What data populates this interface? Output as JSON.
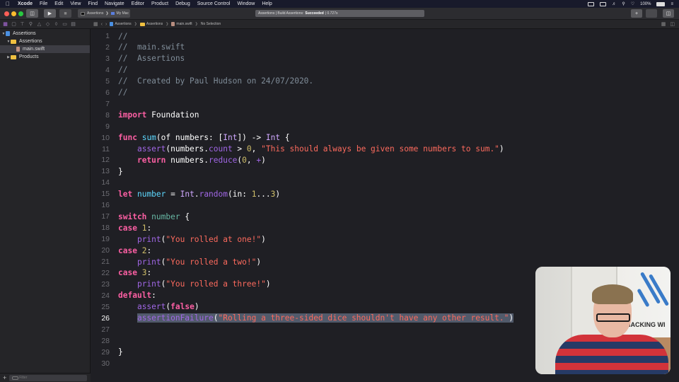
{
  "menubar": {
    "app_name": "Xcode",
    "items": [
      "File",
      "Edit",
      "View",
      "Find",
      "Navigate",
      "Editor",
      "Product",
      "Debug",
      "Source Control",
      "Window",
      "Help"
    ],
    "battery": "100%"
  },
  "toolbar": {
    "scheme": "Assertions",
    "destination": "My Mac",
    "status_prefix": "Assertions | Build Assertions:",
    "status_result": "Succeeded",
    "status_time": "| 0.727s",
    "add_label": "+"
  },
  "jumpbar": {
    "crumbs": [
      "Assertions",
      "Assertions",
      "main.swift",
      "No Selection"
    ]
  },
  "navigator": {
    "items": [
      {
        "label": "Assertions",
        "kind": "project",
        "expanded": true
      },
      {
        "label": "Assertions",
        "kind": "folder",
        "expanded": true
      },
      {
        "label": "main.swift",
        "kind": "swift-file",
        "selected": true
      },
      {
        "label": "Products",
        "kind": "folder",
        "expanded": false
      }
    ],
    "filter_placeholder": "Filter"
  },
  "editor": {
    "current_line": 26,
    "lines": [
      {
        "n": "1",
        "tokens": [
          [
            "c-comment",
            "//"
          ]
        ]
      },
      {
        "n": "2",
        "tokens": [
          [
            "c-comment",
            "//  main.swift"
          ]
        ]
      },
      {
        "n": "3",
        "tokens": [
          [
            "c-comment",
            "//  Assertions"
          ]
        ]
      },
      {
        "n": "4",
        "tokens": [
          [
            "c-comment",
            "//"
          ]
        ]
      },
      {
        "n": "5",
        "tokens": [
          [
            "c-comment",
            "//  Created by Paul Hudson on 24/07/2020."
          ]
        ]
      },
      {
        "n": "6",
        "tokens": [
          [
            "c-comment",
            "//"
          ]
        ]
      },
      {
        "n": "7",
        "tokens": []
      },
      {
        "n": "8",
        "tokens": [
          [
            "c-kw",
            "import"
          ],
          [
            "c-plain",
            " Foundation"
          ]
        ]
      },
      {
        "n": "9",
        "tokens": []
      },
      {
        "n": "10",
        "tokens": [
          [
            "c-kw",
            "func"
          ],
          [
            "c-plain",
            " "
          ],
          [
            "c-decl",
            "sum"
          ],
          [
            "c-plain",
            "(of numbers: ["
          ],
          [
            "c-typeref",
            "Int"
          ],
          [
            "c-plain",
            "]) -> "
          ],
          [
            "c-typeref",
            "Int"
          ],
          [
            "c-plain",
            " {"
          ]
        ]
      },
      {
        "n": "11",
        "tokens": [
          [
            "c-plain",
            "    "
          ],
          [
            "c-call",
            "assert"
          ],
          [
            "c-plain",
            "(numbers."
          ],
          [
            "c-mem",
            "count"
          ],
          [
            "c-plain",
            " > "
          ],
          [
            "c-num",
            "0"
          ],
          [
            "c-plain",
            ", "
          ],
          [
            "c-str",
            "\"This should always be given some numbers to sum.\""
          ],
          [
            "c-plain",
            ")"
          ]
        ]
      },
      {
        "n": "12",
        "tokens": [
          [
            "c-plain",
            "    "
          ],
          [
            "c-kw",
            "return"
          ],
          [
            "c-plain",
            " numbers."
          ],
          [
            "c-mem",
            "reduce"
          ],
          [
            "c-plain",
            "("
          ],
          [
            "c-num",
            "0"
          ],
          [
            "c-plain",
            ", "
          ],
          [
            "c-mem",
            "+"
          ],
          [
            "c-plain",
            ")"
          ]
        ]
      },
      {
        "n": "13",
        "tokens": [
          [
            "c-plain",
            "}"
          ]
        ]
      },
      {
        "n": "14",
        "tokens": []
      },
      {
        "n": "15",
        "tokens": [
          [
            "c-kw",
            "let"
          ],
          [
            "c-plain",
            " "
          ],
          [
            "c-decl",
            "number"
          ],
          [
            "c-plain",
            " = "
          ],
          [
            "c-typeref",
            "Int"
          ],
          [
            "c-plain",
            "."
          ],
          [
            "c-mem",
            "random"
          ],
          [
            "c-plain",
            "(in: "
          ],
          [
            "c-num",
            "1"
          ],
          [
            "c-plain",
            "..."
          ],
          [
            "c-num",
            "3"
          ],
          [
            "c-plain",
            ")"
          ]
        ]
      },
      {
        "n": "16",
        "tokens": []
      },
      {
        "n": "17",
        "tokens": [
          [
            "c-kw",
            "switch"
          ],
          [
            "c-plain",
            " "
          ],
          [
            "c-var",
            "number"
          ],
          [
            "c-plain",
            " {"
          ]
        ]
      },
      {
        "n": "18",
        "tokens": [
          [
            "c-kw",
            "case"
          ],
          [
            "c-plain",
            " "
          ],
          [
            "c-num",
            "1"
          ],
          [
            "c-plain",
            ":"
          ]
        ]
      },
      {
        "n": "19",
        "tokens": [
          [
            "c-plain",
            "    "
          ],
          [
            "c-call",
            "print"
          ],
          [
            "c-plain",
            "("
          ],
          [
            "c-str",
            "\"You rolled at one!\""
          ],
          [
            "c-plain",
            ")"
          ]
        ]
      },
      {
        "n": "20",
        "tokens": [
          [
            "c-kw",
            "case"
          ],
          [
            "c-plain",
            " "
          ],
          [
            "c-num",
            "2"
          ],
          [
            "c-plain",
            ":"
          ]
        ]
      },
      {
        "n": "21",
        "tokens": [
          [
            "c-plain",
            "    "
          ],
          [
            "c-call",
            "print"
          ],
          [
            "c-plain",
            "("
          ],
          [
            "c-str",
            "\"You rolled a two!\""
          ],
          [
            "c-plain",
            ")"
          ]
        ]
      },
      {
        "n": "22",
        "tokens": [
          [
            "c-kw",
            "case"
          ],
          [
            "c-plain",
            " "
          ],
          [
            "c-num",
            "3"
          ],
          [
            "c-plain",
            ":"
          ]
        ]
      },
      {
        "n": "23",
        "tokens": [
          [
            "c-plain",
            "    "
          ],
          [
            "c-call",
            "print"
          ],
          [
            "c-plain",
            "("
          ],
          [
            "c-str",
            "\"You rolled a three!\""
          ],
          [
            "c-plain",
            ")"
          ]
        ]
      },
      {
        "n": "24",
        "tokens": [
          [
            "c-kw",
            "default"
          ],
          [
            "c-plain",
            ":"
          ]
        ]
      },
      {
        "n": "25",
        "tokens": [
          [
            "c-plain",
            "    "
          ],
          [
            "c-call",
            "assert"
          ],
          [
            "c-plain",
            "("
          ],
          [
            "c-kw",
            "false"
          ],
          [
            "c-plain",
            ")"
          ]
        ]
      },
      {
        "n": "26",
        "tokens": [
          [
            "c-plain",
            "    "
          ],
          [
            "c-call hl",
            "assertionFailure"
          ],
          [
            "c-plain hl",
            "("
          ],
          [
            "c-str hl",
            "\"Rolling a three-sided dice shouldn't have any other result.\""
          ],
          [
            "c-plain hl",
            ")"
          ]
        ]
      },
      {
        "n": "27",
        "tokens": []
      },
      {
        "n": "28",
        "tokens": []
      },
      {
        "n": "29",
        "tokens": [
          [
            "c-plain",
            "}"
          ]
        ]
      },
      {
        "n": "30",
        "tokens": []
      }
    ]
  },
  "webcam": {
    "brand_text": "HACKING WI"
  },
  "colors": {
    "keyword": "#fc5fa3",
    "string": "#fc6a5d",
    "number": "#d0bf69",
    "comment": "#7f8c98",
    "call": "#a167e6",
    "declaration": "#5dd8ff",
    "editor_bg": "#1f1f24",
    "selection": "#515a6b"
  }
}
